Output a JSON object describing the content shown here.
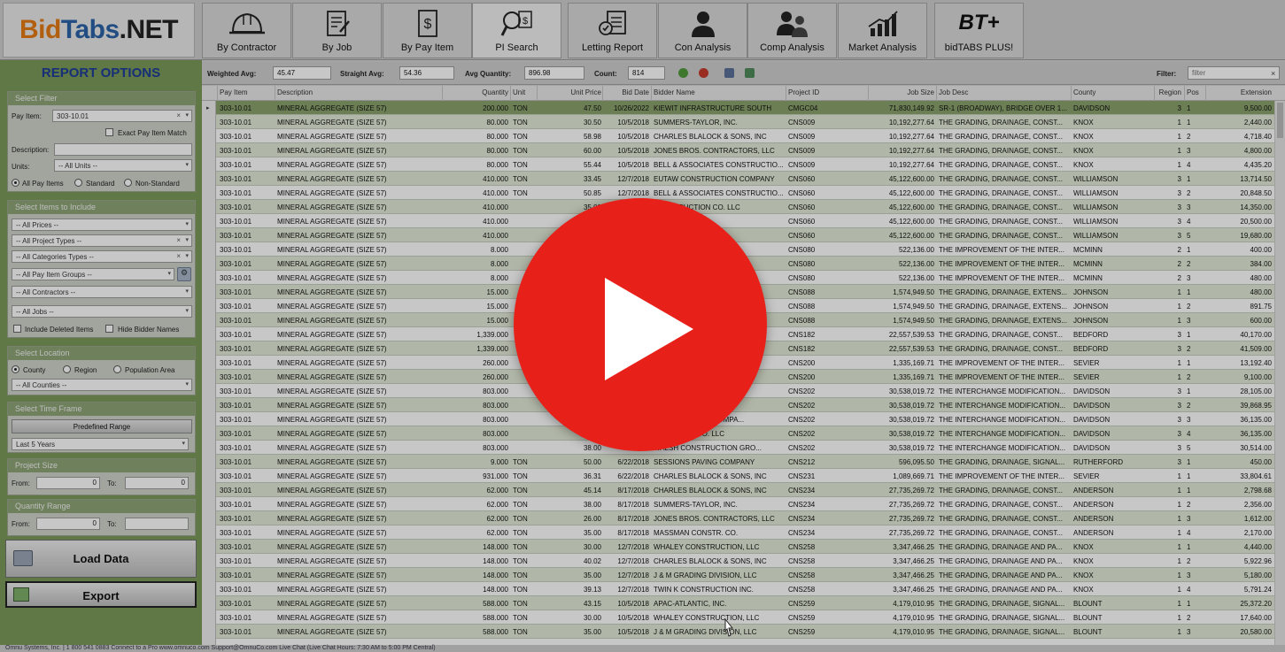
{
  "logo": {
    "part1": "Bid",
    "part2": "Tabs",
    "part3": ".NET"
  },
  "nav_tabs": [
    {
      "label": "By Contractor",
      "icon": "hard-hat-icon"
    },
    {
      "label": "By Job",
      "icon": "document-edit-icon"
    },
    {
      "label": "By Pay Item",
      "icon": "dollar-document-icon"
    },
    {
      "label": "PI Search",
      "icon": "search-dollar-icon"
    },
    {
      "label": "Letting Report",
      "icon": "checklist-icon"
    },
    {
      "label": "Con Analysis",
      "icon": "person-icon"
    },
    {
      "label": "Comp Analysis",
      "icon": "people-icon"
    },
    {
      "label": "Market Analysis",
      "icon": "bar-chart-icon"
    },
    {
      "label": "bidTABS PLUS!",
      "icon": "bt-plus-icon",
      "badge": "BT+"
    }
  ],
  "report_options": {
    "title": "REPORT OPTIONS",
    "select_filter": {
      "header": "Select Filter",
      "pay_item_label": "Pay Item:",
      "pay_item_value": "303-10.01",
      "exact_match_label": "Exact Pay Item Match",
      "description_label": "Description:",
      "description_value": "",
      "units_label": "Units:",
      "units_value": "-- All Units --",
      "radio_all": "All Pay Items",
      "radio_standard": "Standard",
      "radio_nonstandard": "Non-Standard"
    },
    "select_items": {
      "header": "Select Items to Include",
      "prices": "-- All Prices --",
      "project_types": "-- All Project Types --",
      "categories": "-- All Categories Types --",
      "pay_item_groups": "-- All Pay Item Groups --",
      "contractors": "-- All Contractors --",
      "jobs": "-- All Jobs --",
      "include_deleted": "Include Deleted Items",
      "hide_bidder": "Hide Bidder Names"
    },
    "select_location": {
      "header": "Select Location",
      "radio_county": "County",
      "radio_region": "Region",
      "radio_population": "Population Area",
      "counties": "-- All Counties --"
    },
    "time_frame": {
      "header": "Select Time Frame",
      "predefined": "Predefined Range",
      "range_value": "Last 5 Years"
    },
    "project_size": {
      "header": "Project Size",
      "from_label": "From:",
      "from_value": "0",
      "to_label": "To:",
      "to_value": "0"
    },
    "quantity_range": {
      "header": "Quantity Range",
      "from_label": "From:",
      "from_value": "0",
      "to_label": "To:",
      "to_value": ""
    },
    "load_button": "Load Data",
    "export_button": "Export"
  },
  "toolbar": {
    "weighted_label": "Weighted Avg:",
    "weighted_value": "45.47",
    "straight_label": "Straight Avg:",
    "straight_value": "54.36",
    "avgqty_label": "Avg Quantity:",
    "avgqty_value": "896.98",
    "count_label": "Count:",
    "count_value": "814",
    "filter_label": "Filter:",
    "filter_placeholder": "filter"
  },
  "grid": {
    "columns": [
      "Pay Item",
      "Description",
      "Quantity",
      "Unit",
      "Unit Price",
      "Bid Date",
      "Bidder Name",
      "Project ID",
      "Job Size",
      "Job Desc",
      "County",
      "Region",
      "Pos",
      "Extension"
    ],
    "rows": [
      [
        "303-10.01",
        "MINERAL AGGREGATE (SIZE 57)",
        "200.000",
        "TON",
        "47.50",
        "10/26/2022",
        "KIEWIT INFRASTRUCTURE SOUTH",
        "CMGC04",
        "71,830,149.92",
        "SR-1 (BROADWAY), BRIDGE OVER 1...",
        "DAVIDSON",
        "3",
        "1",
        "9,500.00"
      ],
      [
        "303-10.01",
        "MINERAL AGGREGATE (SIZE 57)",
        "80.000",
        "TON",
        "30.50",
        "10/5/2018",
        "SUMMERS-TAYLOR, INC.",
        "CNS009",
        "10,192,277.64",
        "THE GRADING, DRAINAGE, CONST...",
        "KNOX",
        "1",
        "1",
        "2,440.00"
      ],
      [
        "303-10.01",
        "MINERAL AGGREGATE (SIZE 57)",
        "80.000",
        "TON",
        "58.98",
        "10/5/2018",
        "CHARLES BLALOCK & SONS, INC",
        "CNS009",
        "10,192,277.64",
        "THE GRADING, DRAINAGE, CONST...",
        "KNOX",
        "1",
        "2",
        "4,718.40"
      ],
      [
        "303-10.01",
        "MINERAL AGGREGATE (SIZE 57)",
        "80.000",
        "TON",
        "60.00",
        "10/5/2018",
        "JONES BROS. CONTRACTORS, LLC",
        "CNS009",
        "10,192,277.64",
        "THE GRADING, DRAINAGE, CONST...",
        "KNOX",
        "1",
        "3",
        "4,800.00"
      ],
      [
        "303-10.01",
        "MINERAL AGGREGATE (SIZE 57)",
        "80.000",
        "TON",
        "55.44",
        "10/5/2018",
        "BELL & ASSOCIATES CONSTRUCTIO...",
        "CNS009",
        "10,192,277.64",
        "THE GRADING, DRAINAGE, CONST...",
        "KNOX",
        "1",
        "4",
        "4,435.20"
      ],
      [
        "303-10.01",
        "MINERAL AGGREGATE (SIZE 57)",
        "410.000",
        "TON",
        "33.45",
        "12/7/2018",
        "EUTAW CONSTRUCTION COMPANY",
        "CNS060",
        "45,122,600.00",
        "THE GRADING, DRAINAGE, CONST...",
        "WILLIAMSON",
        "3",
        "1",
        "13,714.50"
      ],
      [
        "303-10.01",
        "MINERAL AGGREGATE (SIZE 57)",
        "410.000",
        "TON",
        "50.85",
        "12/7/2018",
        "BELL & ASSOCIATES CONSTRUCTIO...",
        "CNS060",
        "45,122,600.00",
        "THE GRADING, DRAINAGE, CONST...",
        "WILLIAMSON",
        "3",
        "2",
        "20,848.50"
      ],
      [
        "303-10.01",
        "MINERAL AGGREGATE (SIZE 57)",
        "410.000",
        "",
        "35.00",
        "",
        "CONSTRUCTION CO. LLC",
        "CNS060",
        "45,122,600.00",
        "THE GRADING, DRAINAGE, CONST...",
        "WILLIAMSON",
        "3",
        "3",
        "14,350.00"
      ],
      [
        "303-10.01",
        "MINERAL AGGREGATE (SIZE 57)",
        "410.000",
        "",
        "",
        "",
        "TRACTORS, LLC",
        "CNS060",
        "45,122,600.00",
        "THE GRADING, DRAINAGE, CONST...",
        "WILLIAMSON",
        "3",
        "4",
        "20,500.00"
      ],
      [
        "303-10.01",
        "MINERAL AGGREGATE (SIZE 57)",
        "410.000",
        "",
        "",
        "",
        "S, INC.",
        "CNS060",
        "45,122,600.00",
        "THE GRADING, DRAINAGE, CONST...",
        "WILLIAMSON",
        "3",
        "5",
        "19,680.00"
      ],
      [
        "303-10.01",
        "MINERAL AGGREGATE (SIZE 57)",
        "8.000",
        "",
        "",
        "",
        "",
        "CNS080",
        "522,136.00",
        "THE IMPROVEMENT OF THE INTER...",
        "MCMINN",
        "2",
        "1",
        "400.00"
      ],
      [
        "303-10.01",
        "MINERAL AGGREGATE (SIZE 57)",
        "8.000",
        "",
        "",
        "",
        "",
        "CNS080",
        "522,136.00",
        "THE IMPROVEMENT OF THE INTER...",
        "MCMINN",
        "2",
        "2",
        "384.00"
      ],
      [
        "303-10.01",
        "MINERAL AGGREGATE (SIZE 57)",
        "8.000",
        "",
        "",
        "",
        "",
        "CNS080",
        "522,136.00",
        "THE IMPROVEMENT OF THE INTER...",
        "MCMINN",
        "2",
        "3",
        "480.00"
      ],
      [
        "303-10.01",
        "MINERAL AGGREGATE (SIZE 57)",
        "15.000",
        "",
        "",
        "",
        "",
        "CNS088",
        "1,574,949.50",
        "THE GRADING, DRAINAGE, EXTENS...",
        "JOHNSON",
        "1",
        "1",
        "480.00"
      ],
      [
        "303-10.01",
        "MINERAL AGGREGATE (SIZE 57)",
        "15.000",
        "",
        "",
        "",
        "",
        "CNS088",
        "1,574,949.50",
        "THE GRADING, DRAINAGE, EXTENS...",
        "JOHNSON",
        "1",
        "2",
        "891.75"
      ],
      [
        "303-10.01",
        "MINERAL AGGREGATE (SIZE 57)",
        "15.000",
        "",
        "",
        "",
        "",
        "CNS088",
        "1,574,949.50",
        "THE GRADING, DRAINAGE, EXTENS...",
        "JOHNSON",
        "1",
        "3",
        "600.00"
      ],
      [
        "303-10.01",
        "MINERAL AGGREGATE (SIZE 57)",
        "1,339.000",
        "",
        "",
        "",
        "LC",
        "CNS182",
        "22,557,539.53",
        "THE GRADING, DRAINAGE, CONST...",
        "BEDFORD",
        "3",
        "1",
        "40,170.00"
      ],
      [
        "303-10.01",
        "MINERAL AGGREGATE (SIZE 57)",
        "1,339.000",
        "",
        "",
        "",
        "",
        "CNS182",
        "22,557,539.53",
        "THE GRADING, DRAINAGE, CONST...",
        "BEDFORD",
        "3",
        "2",
        "41,509.00"
      ],
      [
        "303-10.01",
        "MINERAL AGGREGATE (SIZE 57)",
        "260.000",
        "",
        "",
        "",
        "C",
        "CNS200",
        "1,335,169.71",
        "THE IMPROVEMENT OF THE INTER...",
        "SEVIER",
        "1",
        "1",
        "13,192.40"
      ],
      [
        "303-10.01",
        "MINERAL AGGREGATE (SIZE 57)",
        "260.000",
        "",
        "",
        "",
        "",
        "CNS200",
        "1,335,169.71",
        "THE IMPROVEMENT OF THE INTER...",
        "SEVIER",
        "1",
        "2",
        "9,100.00"
      ],
      [
        "303-10.01",
        "MINERAL AGGREGATE (SIZE 57)",
        "803.000",
        "",
        "",
        "",
        "RS, LLC",
        "CNS202",
        "30,538,019.72",
        "THE INTERCHANGE MODIFICATION...",
        "DAVIDSON",
        "3",
        "1",
        "28,105.00"
      ],
      [
        "303-10.01",
        "MINERAL AGGREGATE (SIZE 57)",
        "803.000",
        "",
        "",
        "",
        "NSTRUCTIO...",
        "CNS202",
        "30,538,019.72",
        "THE INTERCHANGE MODIFICATION...",
        "DAVIDSON",
        "3",
        "2",
        "39,868.95"
      ],
      [
        "303-10.01",
        "MINERAL AGGREGATE (SIZE 57)",
        "803.000",
        "",
        "",
        "",
        "CONSTRUCTION COMPA...",
        "CNS202",
        "30,538,019.72",
        "THE INTERCHANGE MODIFICATION...",
        "DAVIDSON",
        "3",
        "3",
        "36,135.00"
      ],
      [
        "303-10.01",
        "MINERAL AGGREGATE (SIZE 57)",
        "803.000",
        "",
        "",
        "",
        "STRUCTION CO. LLC",
        "CNS202",
        "30,538,019.72",
        "THE INTERCHANGE MODIFICATION...",
        "DAVIDSON",
        "3",
        "4",
        "36,135.00"
      ],
      [
        "303-10.01",
        "MINERAL AGGREGATE (SIZE 57)",
        "803.000",
        "",
        "38.00",
        "",
        "WALSH CONSTRUCTION GRO...",
        "CNS202",
        "30,538,019.72",
        "THE INTERCHANGE MODIFICATION...",
        "DAVIDSON",
        "3",
        "5",
        "30,514.00"
      ],
      [
        "303-10.01",
        "MINERAL AGGREGATE (SIZE 57)",
        "9.000",
        "TON",
        "50.00",
        "6/22/2018",
        "SESSIONS PAVING COMPANY",
        "CNS212",
        "596,095.50",
        "THE GRADING, DRAINAGE, SIGNAL...",
        "RUTHERFORD",
        "3",
        "1",
        "450.00"
      ],
      [
        "303-10.01",
        "MINERAL AGGREGATE (SIZE 57)",
        "931.000",
        "TON",
        "36.31",
        "6/22/2018",
        "CHARLES BLALOCK & SONS, INC",
        "CNS231",
        "1,089,669.71",
        "THE IMPROVEMENT OF THE INTER...",
        "SEVIER",
        "1",
        "1",
        "33,804.61"
      ],
      [
        "303-10.01",
        "MINERAL AGGREGATE (SIZE 57)",
        "62.000",
        "TON",
        "45.14",
        "8/17/2018",
        "CHARLES BLALOCK & SONS, INC",
        "CNS234",
        "27,735,269.72",
        "THE GRADING, DRAINAGE, CONST...",
        "ANDERSON",
        "1",
        "1",
        "2,798.68"
      ],
      [
        "303-10.01",
        "MINERAL AGGREGATE (SIZE 57)",
        "62.000",
        "TON",
        "38.00",
        "8/17/2018",
        "SUMMERS-TAYLOR, INC.",
        "CNS234",
        "27,735,269.72",
        "THE GRADING, DRAINAGE, CONST...",
        "ANDERSON",
        "1",
        "2",
        "2,356.00"
      ],
      [
        "303-10.01",
        "MINERAL AGGREGATE (SIZE 57)",
        "62.000",
        "TON",
        "26.00",
        "8/17/2018",
        "JONES BROS. CONTRACTORS, LLC",
        "CNS234",
        "27,735,269.72",
        "THE GRADING, DRAINAGE, CONST...",
        "ANDERSON",
        "1",
        "3",
        "1,612.00"
      ],
      [
        "303-10.01",
        "MINERAL AGGREGATE (SIZE 57)",
        "62.000",
        "TON",
        "35.00",
        "8/17/2018",
        "MASSMAN CONSTR. CO.",
        "CNS234",
        "27,735,269.72",
        "THE GRADING, DRAINAGE, CONST...",
        "ANDERSON",
        "1",
        "4",
        "2,170.00"
      ],
      [
        "303-10.01",
        "MINERAL AGGREGATE (SIZE 57)",
        "148.000",
        "TON",
        "30.00",
        "12/7/2018",
        "WHALEY CONSTRUCTION, LLC",
        "CNS258",
        "3,347,466.25",
        "THE GRADING, DRAINAGE AND PA...",
        "KNOX",
        "1",
        "1",
        "4,440.00"
      ],
      [
        "303-10.01",
        "MINERAL AGGREGATE (SIZE 57)",
        "148.000",
        "TON",
        "40.02",
        "12/7/2018",
        "CHARLES BLALOCK & SONS, INC",
        "CNS258",
        "3,347,466.25",
        "THE GRADING, DRAINAGE AND PA...",
        "KNOX",
        "1",
        "2",
        "5,922.96"
      ],
      [
        "303-10.01",
        "MINERAL AGGREGATE (SIZE 57)",
        "148.000",
        "TON",
        "35.00",
        "12/7/2018",
        "J & M GRADING DIVISION, LLC",
        "CNS258",
        "3,347,466.25",
        "THE GRADING, DRAINAGE AND PA...",
        "KNOX",
        "1",
        "3",
        "5,180.00"
      ],
      [
        "303-10.01",
        "MINERAL AGGREGATE (SIZE 57)",
        "148.000",
        "TON",
        "39.13",
        "12/7/2018",
        "TWIN K CONSTRUCTION INC.",
        "CNS258",
        "3,347,466.25",
        "THE GRADING, DRAINAGE AND PA...",
        "KNOX",
        "1",
        "4",
        "5,791.24"
      ],
      [
        "303-10.01",
        "MINERAL AGGREGATE (SIZE 57)",
        "588.000",
        "TON",
        "43.15",
        "10/5/2018",
        "APAC-ATLANTIC, INC.",
        "CNS259",
        "4,179,010.95",
        "THE GRADING, DRAINAGE, SIGNAL...",
        "BLOUNT",
        "1",
        "1",
        "25,372.20"
      ],
      [
        "303-10.01",
        "MINERAL AGGREGATE (SIZE 57)",
        "588.000",
        "TON",
        "30.00",
        "10/5/2018",
        "WHALEY CONSTRUCTION, LLC",
        "CNS259",
        "4,179,010.95",
        "THE GRADING, DRAINAGE, SIGNAL...",
        "BLOUNT",
        "1",
        "2",
        "17,640.00"
      ],
      [
        "303-10.01",
        "MINERAL AGGREGATE (SIZE 57)",
        "588.000",
        "TON",
        "35.00",
        "10/5/2018",
        "J & M GRADING DIVISION, LLC",
        "CNS259",
        "4,179,010.95",
        "THE GRADING, DRAINAGE, SIGNAL...",
        "BLOUNT",
        "1",
        "3",
        "20,580.00"
      ]
    ]
  },
  "footer": {
    "text": "Omnu Systems, Inc. | 1 800 541 0883     Connect to a Pro     www.omnuco.com     Support@OmnuCo.com     Live Chat     (Live Chat Hours: 7:30 AM to 5:00 PM Central)"
  },
  "overlay": {
    "icon": "play-icon",
    "color": "#e8201a"
  }
}
